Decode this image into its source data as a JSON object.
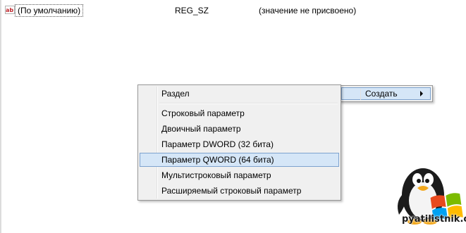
{
  "registry": {
    "value_name": "(По умолчанию)",
    "value_type": "REG_SZ",
    "value_data": "(значение не присвоено)",
    "value_icon": "string-value-icon"
  },
  "context_menu": {
    "create_label": "Создать"
  },
  "submenu": {
    "key_label": "Раздел",
    "items": [
      {
        "label": "Строковый параметр",
        "selected": false
      },
      {
        "label": "Двоичный параметр",
        "selected": false
      },
      {
        "label": "Параметр DWORD (32 бита)",
        "selected": false
      },
      {
        "label": "Параметр QWORD (64 бита)",
        "selected": true
      },
      {
        "label": "Мультистроковый параметр",
        "selected": false
      },
      {
        "label": "Расширяемый строковый параметр",
        "selected": false
      }
    ]
  },
  "watermark": {
    "text": "pyatilistnik.org",
    "icon": "penguin-windows-logo"
  },
  "colors": {
    "menu_background": "#f0f0f0",
    "highlight_fill": "#d5e6f7",
    "highlight_border": "#7da2ce"
  }
}
